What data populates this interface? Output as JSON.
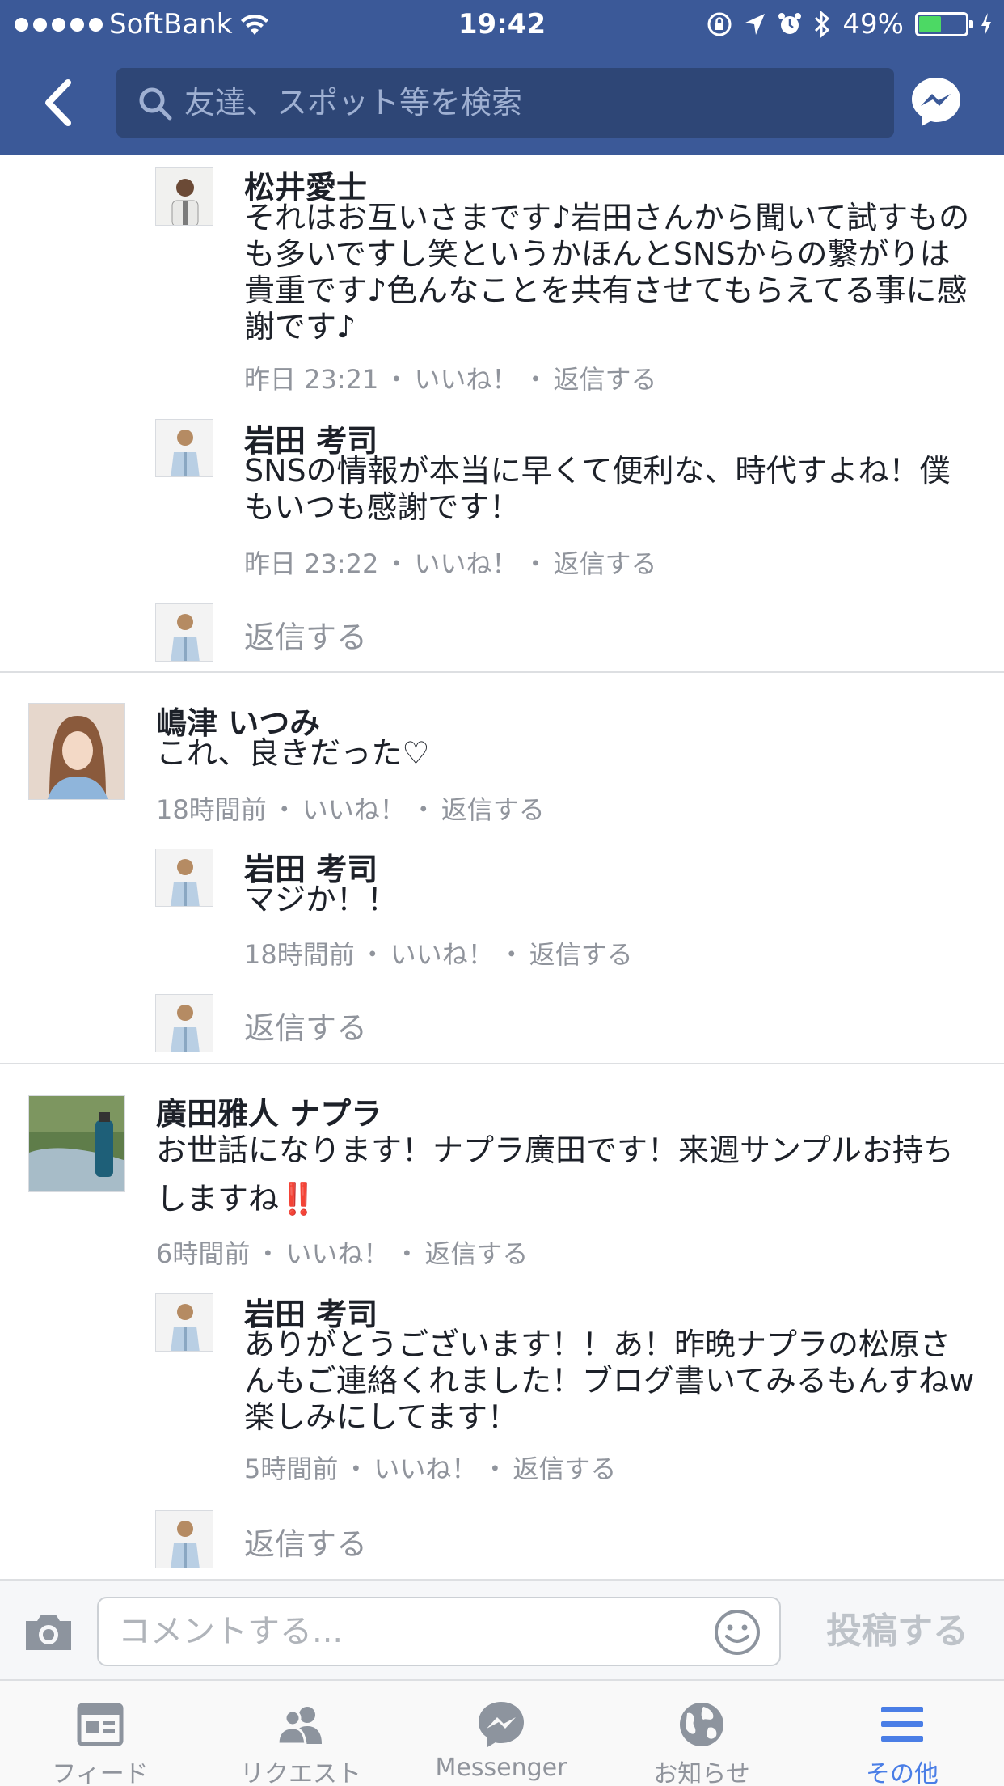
{
  "status_bar": {
    "carrier": "SoftBank",
    "time": "19:42",
    "battery_percent": "49%",
    "battery_level": 0.49,
    "icons": [
      "wifi-icon",
      "orientation-lock-icon",
      "location-icon",
      "alarm-icon",
      "bluetooth-icon",
      "charging-icon"
    ]
  },
  "header": {
    "search_placeholder": "友達、スポット等を検索",
    "back_icon": "chevron-left-icon",
    "messenger_icon": "messenger-icon"
  },
  "threads": [
    {
      "replies": [
        {
          "author": "松井愛士",
          "text": "それはお互いさまです♪岩田さんから聞いて試すものも多いですし笑というかほんとSNSからの繋がりは貴重です♪色んなことを共有させてもらえてる事に感謝です♪",
          "time": "昨日 23:21",
          "like": "いいね！",
          "reply": "返信する"
        },
        {
          "author": "岩田 考司",
          "text": "SNSの情報が本当に早くて便利な、時代すよね！僕もいつも感謝です！",
          "time": "昨日 23:22",
          "like": "いいね！",
          "reply": "返信する"
        }
      ],
      "reply_prompt": "返信する"
    },
    {
      "author": "嶋津 いつみ",
      "text": "これ、良きだった♡",
      "time": "18時間前",
      "like": "いいね！",
      "reply": "返信する",
      "replies": [
        {
          "author": "岩田 考司",
          "text": "マジか！！",
          "time": "18時間前",
          "like": "いいね！",
          "reply": "返信する"
        }
      ],
      "reply_prompt": "返信する"
    },
    {
      "author": "廣田雅人 ナプラ",
      "text": "お世話になります！ナプラ廣田です！来週サンプルお持ちしますね",
      "emoji": "‼️",
      "time": "6時間前",
      "like": "いいね！",
      "reply": "返信する",
      "replies": [
        {
          "author": "岩田 考司",
          "text": "ありがとうございます！！あ！昨晩ナプラの松原さんもご連絡くれました！ブログ書いてみるもんすねw楽しみにしてます！",
          "time": "5時間前",
          "like": "いいね！",
          "reply": "返信する"
        }
      ],
      "reply_prompt": "返信する"
    }
  ],
  "composer": {
    "placeholder": "コメントする...",
    "post_label": "投稿する"
  },
  "tabs": [
    {
      "label": "フィード",
      "icon": "feed-icon"
    },
    {
      "label": "リクエスト",
      "icon": "friend-requests-icon"
    },
    {
      "label": "Messenger",
      "icon": "messenger-icon"
    },
    {
      "label": "お知らせ",
      "icon": "globe-icon"
    },
    {
      "label": "その他",
      "icon": "menu-icon",
      "active": true
    }
  ],
  "colors": {
    "header_bg": "#3b5998",
    "search_bg": "#2e4676",
    "meta_text": "#90949c",
    "active_tab": "#4a7ee6",
    "battery_fill": "#4cd964"
  }
}
